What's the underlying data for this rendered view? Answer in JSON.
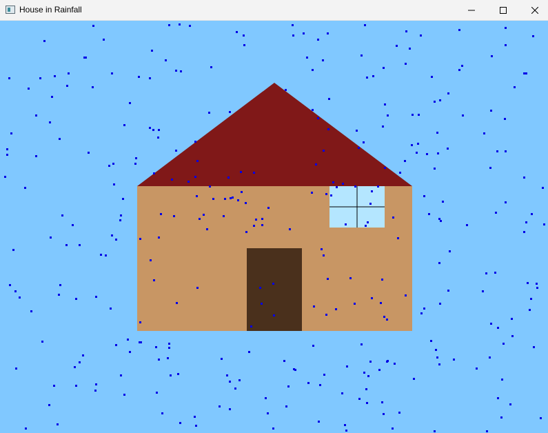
{
  "window": {
    "title": "House in Rainfall",
    "icon": "app-window-icon"
  },
  "titlebar_controls": [
    {
      "name": "minimize-button",
      "icon": "minimize-icon"
    },
    {
      "name": "maximize-button",
      "icon": "maximize-icon"
    },
    {
      "name": "close-button",
      "icon": "close-icon"
    }
  ],
  "colors": {
    "sky": "#80c8ff",
    "roof": "#801818",
    "wall": "#c89664",
    "door": "#4a301c",
    "window_glass": "#b4e6ff",
    "window_frame": "#000000",
    "rain": "#0000e6"
  }
}
